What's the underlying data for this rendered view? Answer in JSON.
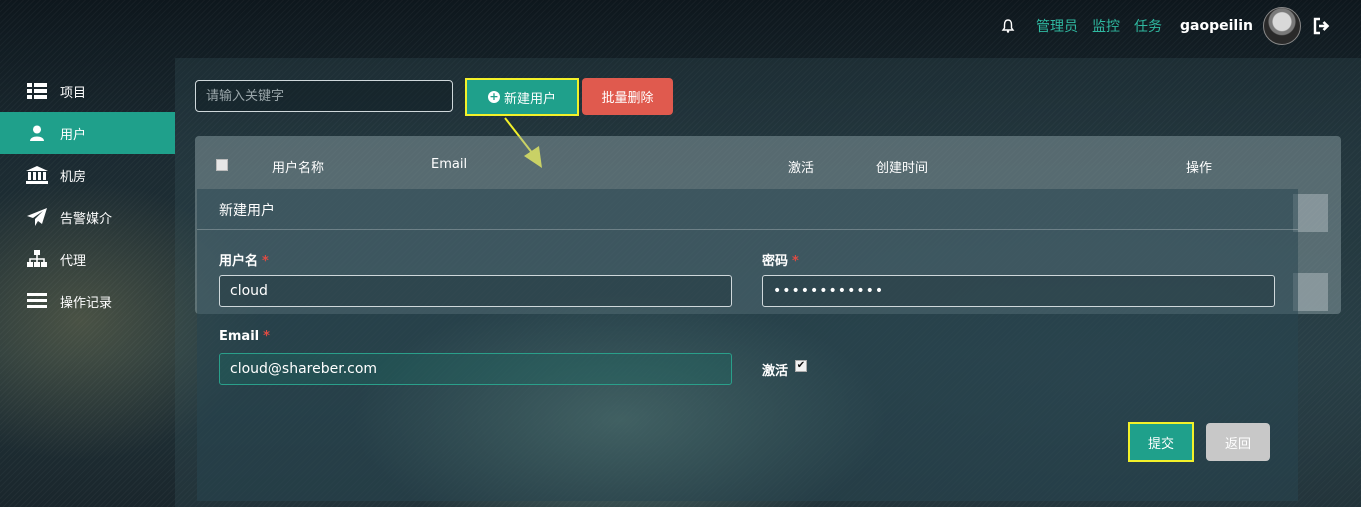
{
  "header": {
    "nav": [
      {
        "label": "管理员"
      },
      {
        "label": "监控"
      },
      {
        "label": "任务"
      }
    ],
    "username": "gaopeilin",
    "icons": {
      "bell": "bell-icon",
      "logout": "logout-icon",
      "avatar": "avatar"
    }
  },
  "sidebar": {
    "items": [
      {
        "label": "项目",
        "icon": "list-icon"
      },
      {
        "label": "用户",
        "icon": "user-icon",
        "active": true
      },
      {
        "label": "机房",
        "icon": "bank-icon"
      },
      {
        "label": "告警媒介",
        "icon": "paper-plane-icon"
      },
      {
        "label": "代理",
        "icon": "sitemap-icon"
      },
      {
        "label": "操作记录",
        "icon": "bars-icon"
      }
    ]
  },
  "toolbar": {
    "search_placeholder": "请输入关键字",
    "new_user_label": "新建用户",
    "batch_delete_label": "批量删除"
  },
  "table": {
    "columns": [
      "用户名称",
      "Email",
      "激活",
      "创建时间",
      "操作"
    ]
  },
  "modal": {
    "title": "新建用户",
    "username_label": "用户名",
    "username_value": "cloud",
    "password_label": "密码",
    "password_value": "••••••••••••",
    "email_label": "Email",
    "email_value": "cloud@shareber.com",
    "active_label": "激活",
    "active_checked": true,
    "required_mark": "*",
    "submit_label": "提交",
    "back_label": "返回"
  },
  "colors": {
    "accent": "#1fa08b",
    "danger": "#e05a4e",
    "highlight": "#f3f12a",
    "link": "#2fb8a0"
  }
}
